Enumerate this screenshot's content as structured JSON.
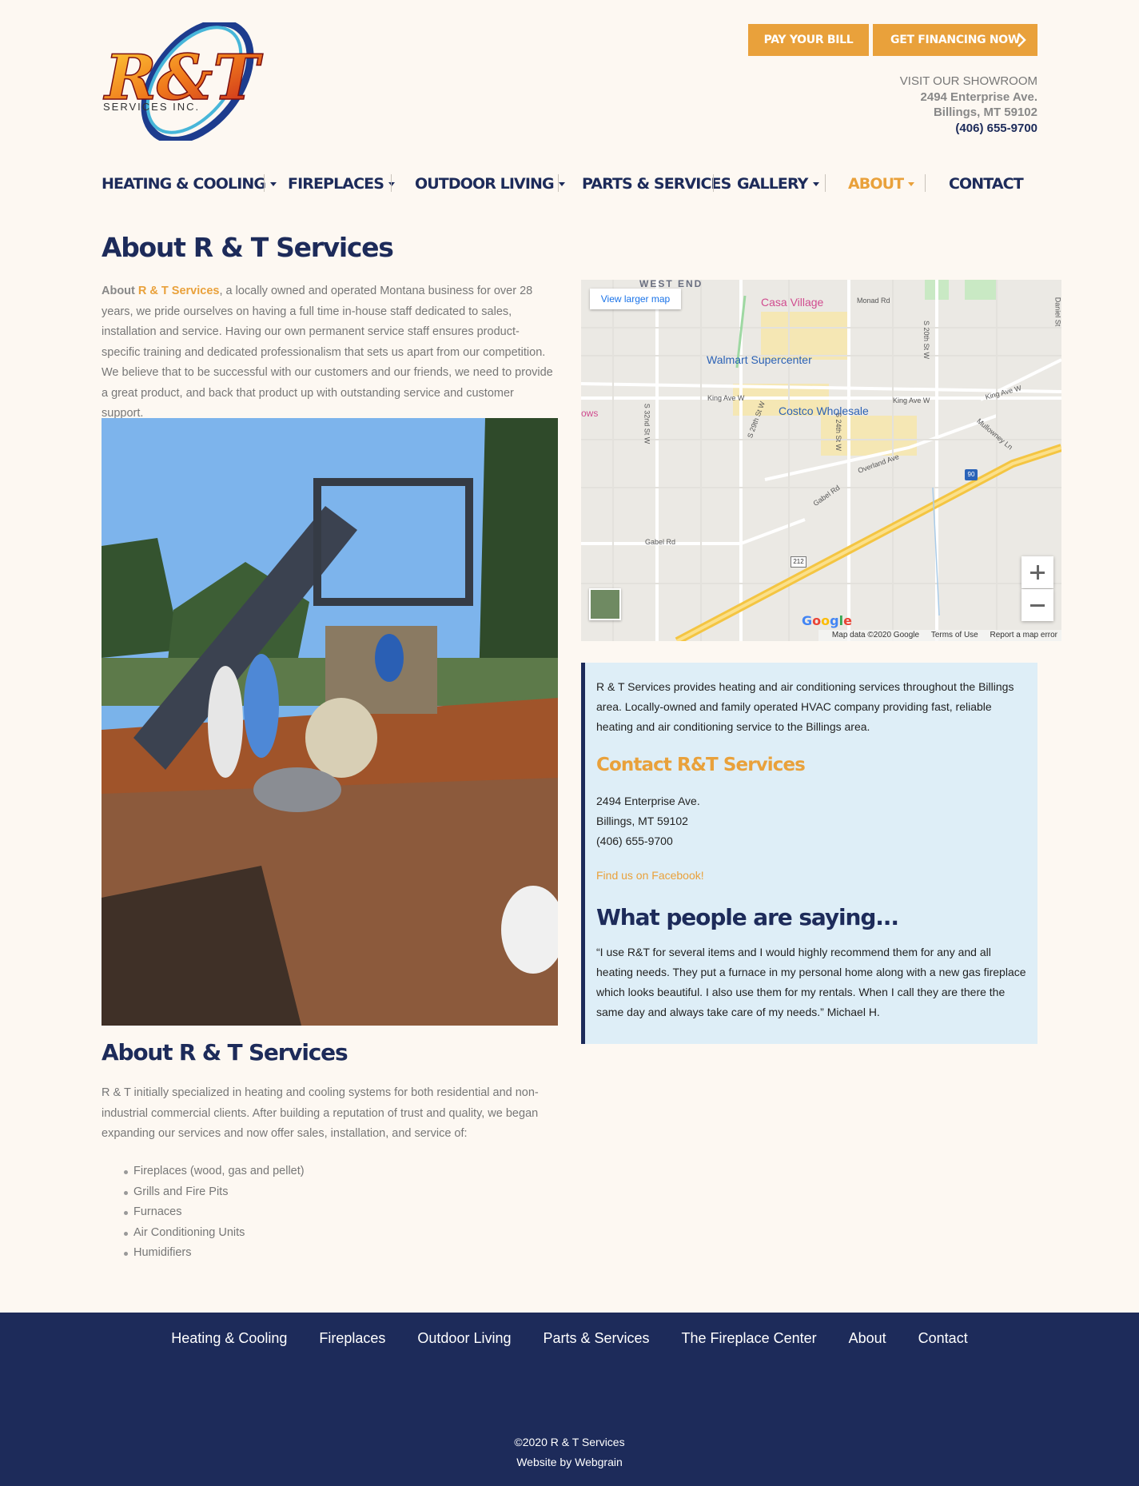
{
  "brand": {
    "logo_text": "R&T",
    "logo_sub": "SERVICES INC.",
    "colors": {
      "navy": "#1d2b5a",
      "orange": "#e9a13b",
      "cream": "#fdf8f2",
      "info_bg": "#deeef7"
    }
  },
  "header": {
    "pay_label": "PAY YOUR BILL",
    "financing_label": "GET FINANCING NOW",
    "showroom_label": "VISIT OUR SHOWROOM",
    "address1": "2494 Enterprise Ave.",
    "address2": "Billings, MT 59102",
    "phone": "(406) 655-9700"
  },
  "nav": {
    "items": [
      {
        "label": "HEATING & COOLING",
        "dropdown": true
      },
      {
        "label": "FIREPLACES",
        "dropdown": true
      },
      {
        "label": "OUTDOOR LIVING",
        "dropdown": true
      },
      {
        "label": "PARTS & SERVICES",
        "dropdown": false
      },
      {
        "label": "GALLERY",
        "dropdown": true
      },
      {
        "label": "ABOUT",
        "dropdown": true,
        "active": true
      },
      {
        "label": "CONTACT",
        "dropdown": false
      }
    ]
  },
  "main": {
    "title": "About R & T Services",
    "intro_lead": "About ",
    "intro_link": "R & T Services",
    "intro_rest": ", a locally owned and operated Montana business for over 28 years, we pride ourselves on having a full time in-house staff dedicated to sales, installation and service. Having our own permanent service staff ensures product-specific training and dedicated professionalism that sets us apart from our competition. We believe that to be successful with our customers and our friends, we need to provide a great product, and back that product up with outstanding service and customer support.",
    "subtitle": "About R & T Services",
    "para2": "R & T initially specialized in heating and cooling systems for both residential and non-industrial commercial clients. After building a reputation of trust and quality, we began expanding our services and now offer sales, installation, and service of:",
    "services": [
      "Fireplaces (wood, gas and pellet)",
      "Grills and Fire Pits",
      "Furnaces",
      "Air Conditioning Units",
      "Humidifiers"
    ]
  },
  "map": {
    "view_larger": "View larger map",
    "area_label": "WEST END",
    "pois": [
      "Casa Village",
      "Walmart Supercenter",
      "Costco Wholesale"
    ],
    "streets": [
      "Monad Rd",
      "King Ave W",
      "King Ave W",
      "King Ave W",
      "S 32nd St W",
      "S 29th St W",
      "S 24th St W",
      "S 20th St W",
      "Daniel St",
      "Overland Ave",
      "Gabel Rd",
      "Gabel Rd",
      "Mullowney Ln"
    ],
    "shields": [
      "90",
      "212"
    ],
    "partial_label": "ows",
    "google": "Google",
    "footer_data": "Map data ©2020 Google",
    "footer_terms": "Terms of Use",
    "footer_report": "Report a map error"
  },
  "info": {
    "desc": "R & T Services provides heating and air conditioning services throughout the Billings area. Locally-owned and family operated HVAC company providing fast, reliable heating and air conditioning service to the Billings area.",
    "contact_title": "Contact R&T Services",
    "address1": "2494 Enterprise Ave.",
    "address2": "Billings, MT 59102",
    "phone": "(406) 655-9700",
    "facebook": "Find us on Facebook!",
    "testimonials_title": "What people are saying...",
    "quote": "“I use R&T for several items and I would highly recommend them for any and all heating needs. They put a furnace in my personal home along with a new gas fireplace which looks beautiful. I also use them for my rentals. When I call they are there the same day and always take care of my needs.” Michael H."
  },
  "footer": {
    "links": [
      "Heating & Cooling",
      "Fireplaces",
      "Outdoor Living",
      "Parts & Services",
      "The Fireplace Center",
      "About",
      "Contact"
    ],
    "copyright": "©2020 R & T Services",
    "credit": "Website by Webgrain"
  }
}
